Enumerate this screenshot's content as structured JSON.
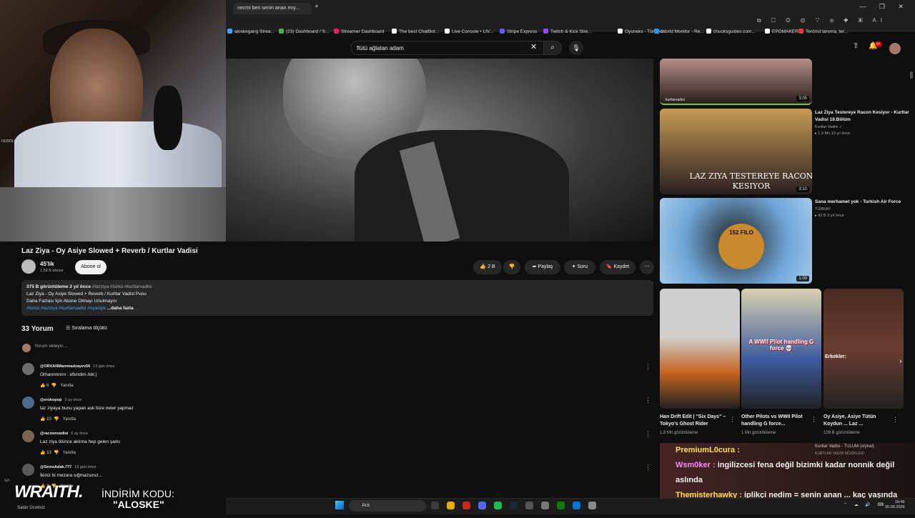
{
  "browser": {
    "tab_title": "necmi ben senin anan mıy...",
    "new_tab": "+",
    "window_controls": "— ❐ ✕"
  },
  "bookmarks": [
    {
      "label": "aloskegang Strea...",
      "color": "#3ea6ff"
    },
    {
      "label": "(23) Dashboard / S...",
      "color": "#4caf50"
    },
    {
      "label": "Streamer Dashboard",
      "color": "#e91e63"
    },
    {
      "label": "The best ChatBot...",
      "color": "#ffffff"
    },
    {
      "label": "Live Console • LIV...",
      "color": "#ffffff"
    },
    {
      "label": "Stripe Express",
      "color": "#635bff"
    },
    {
      "label": "Twitch & Kick Stre...",
      "color": "#9146ff"
    },
    {
      "label": "Oyuneks - Türkiye...",
      "color": "#ffffff"
    },
    {
      "label": "World Monitor - Re...",
      "color": "#2196f3"
    },
    {
      "label": "chucksguides.com...",
      "color": "#ffffff"
    },
    {
      "label": "EPOMAKER",
      "color": "#ffffff"
    },
    {
      "label": "Terörist tanıma, ter...",
      "color": "#e53935"
    }
  ],
  "youtube": {
    "search_value": "flütü ağlatan adam",
    "notif_count": "9+",
    "video_title": "Laz Ziya - Oy Asiye Slowed + Reverb / Kurtlar Vadisi",
    "channel": {
      "name": "45'lik",
      "subs": "1,58 B abone",
      "subscribe_label": "Abone ol"
    },
    "actions": {
      "likes": "2 B",
      "share": "Paylaş",
      "ask": "Soru",
      "save": "Kaydet"
    },
    "description": {
      "meta": "375 B görüntüleme  2 yıl önce",
      "meta_tags": "#lazziya #türkü #kurtlarvadisi",
      "line1": "Laz Ziya - Oy Asiye Slowed + Reverb / Kurtlar Vadisi Pusu",
      "line2": "Daha Fazlası İçin Abone Olmayı Unutmayın",
      "tags": "#türkü #lazziya #kurtlarvadisi #oyasiye",
      "more": "...daha fazla"
    },
    "comments_count": "33 Yorum",
    "sort_label": "Sıralama ölçütü:",
    "add_comment": "Yorum ekleyin...",
    "comments": [
      {
        "user": "@ORXANMammadzayev56",
        "time": "13 gün önce",
        "text": "Orhannnnnn : efendim Abi:)",
        "likes": "6",
        "reply": "Yanıtla"
      },
      {
        "user": "@erokopop",
        "time": "3 ay önce",
        "text": "laz ziyaya bunu yapan ask bize neler  yapmaz",
        "likes": "10",
        "reply": "Yanıtla"
      },
      {
        "user": "@racoonvadisi",
        "time": "6 ay önce",
        "text": "Laz ziya ölünce aklıma hep gelen şarkı",
        "likes": "13",
        "reply": "Yanıtla"
      },
      {
        "user": "@SemsAdak.777",
        "time": "13 gün önce",
        "text": "İkiniz bi mezara sığmazsınız...",
        "likes": "3",
        "reply": "Yanıtla"
      }
    ],
    "related": [
      {
        "title": "",
        "channel": "",
        "meta": "",
        "duration": "3:05",
        "watermark": "kurtlarvadisi"
      },
      {
        "title": "Laz Ziya Testereye Racon Kesiyor - Kurtlar Vadisi 19.Bölüm",
        "channel": "Kurtlar Vadisi ✓",
        "meta": "▸ 1,9 Mn  10 yıl önce",
        "duration": "3:10",
        "overlay": "LAZ ZIYA TESTEREYE RACON KESIYOR"
      },
      {
        "title": "Sana merhamet yok - Turkish Air Force",
        "channel": "TÜRKAY",
        "meta": "▸ 42 B  3 yıl önce",
        "duration": "1:00",
        "overlay": "152 FILO"
      }
    ],
    "shorts": [
      {
        "title": "Han Drift Edit | \"Six Days\" – Tokyo's Ghost Rider",
        "views": "1,8 Mn görüntüleme"
      },
      {
        "title": "Other Pilots vs WWII Pilot handling G force... ",
        "views": "1 Mn görüntüleme",
        "overlay": "A WWII Pilot handling G force 💀"
      },
      {
        "title": "Oy Asiye, Asiye Tütün Koydun ...          Laz ...",
        "views": "109 B görüntüleme",
        "overlay": "Erkekler:"
      }
    ],
    "music_card": {
      "title": "Kurtlar Vadisi - TULUM (orjinal)",
      "sub": "KURTLAR VADISI MÜZİKLERİ"
    }
  },
  "chat": [
    {
      "user": "PremiumL0cura :",
      "msg": ""
    },
    {
      "user": "Wsm0ker :",
      "msg": "ingilizcesi fena değil bizimki kadar nonnik değil aslında"
    },
    {
      "user": "Themisterhawky :",
      "msg": "iplikçi nedim = senin anan ... kaç yaşında canim"
    }
  ],
  "overlay": {
    "brand": "WRAITH.",
    "promo_label": "İNDİRİM KODU:",
    "promo_code": "\"ALOSKE\"",
    "cam_tag": "OUDOLU",
    "ds": "GX",
    "bot": "Saldır Ücretsiz"
  },
  "taskbar": {
    "search": "Ara",
    "time": "18:46",
    "date": "30.08.2026"
  }
}
